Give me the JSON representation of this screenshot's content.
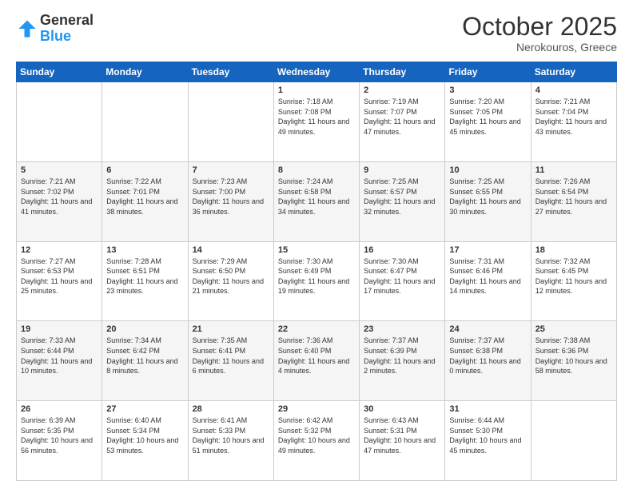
{
  "header": {
    "logo": {
      "general": "General",
      "blue": "Blue"
    },
    "month": "October 2025",
    "location": "Nerokouros, Greece"
  },
  "days_of_week": [
    "Sunday",
    "Monday",
    "Tuesday",
    "Wednesday",
    "Thursday",
    "Friday",
    "Saturday"
  ],
  "weeks": [
    [
      {
        "day": "",
        "info": ""
      },
      {
        "day": "",
        "info": ""
      },
      {
        "day": "",
        "info": ""
      },
      {
        "day": "1",
        "info": "Sunrise: 7:18 AM\nSunset: 7:08 PM\nDaylight: 11 hours and 49 minutes."
      },
      {
        "day": "2",
        "info": "Sunrise: 7:19 AM\nSunset: 7:07 PM\nDaylight: 11 hours and 47 minutes."
      },
      {
        "day": "3",
        "info": "Sunrise: 7:20 AM\nSunset: 7:05 PM\nDaylight: 11 hours and 45 minutes."
      },
      {
        "day": "4",
        "info": "Sunrise: 7:21 AM\nSunset: 7:04 PM\nDaylight: 11 hours and 43 minutes."
      }
    ],
    [
      {
        "day": "5",
        "info": "Sunrise: 7:21 AM\nSunset: 7:02 PM\nDaylight: 11 hours and 41 minutes."
      },
      {
        "day": "6",
        "info": "Sunrise: 7:22 AM\nSunset: 7:01 PM\nDaylight: 11 hours and 38 minutes."
      },
      {
        "day": "7",
        "info": "Sunrise: 7:23 AM\nSunset: 7:00 PM\nDaylight: 11 hours and 36 minutes."
      },
      {
        "day": "8",
        "info": "Sunrise: 7:24 AM\nSunset: 6:58 PM\nDaylight: 11 hours and 34 minutes."
      },
      {
        "day": "9",
        "info": "Sunrise: 7:25 AM\nSunset: 6:57 PM\nDaylight: 11 hours and 32 minutes."
      },
      {
        "day": "10",
        "info": "Sunrise: 7:25 AM\nSunset: 6:55 PM\nDaylight: 11 hours and 30 minutes."
      },
      {
        "day": "11",
        "info": "Sunrise: 7:26 AM\nSunset: 6:54 PM\nDaylight: 11 hours and 27 minutes."
      }
    ],
    [
      {
        "day": "12",
        "info": "Sunrise: 7:27 AM\nSunset: 6:53 PM\nDaylight: 11 hours and 25 minutes."
      },
      {
        "day": "13",
        "info": "Sunrise: 7:28 AM\nSunset: 6:51 PM\nDaylight: 11 hours and 23 minutes."
      },
      {
        "day": "14",
        "info": "Sunrise: 7:29 AM\nSunset: 6:50 PM\nDaylight: 11 hours and 21 minutes."
      },
      {
        "day": "15",
        "info": "Sunrise: 7:30 AM\nSunset: 6:49 PM\nDaylight: 11 hours and 19 minutes."
      },
      {
        "day": "16",
        "info": "Sunrise: 7:30 AM\nSunset: 6:47 PM\nDaylight: 11 hours and 17 minutes."
      },
      {
        "day": "17",
        "info": "Sunrise: 7:31 AM\nSunset: 6:46 PM\nDaylight: 11 hours and 14 minutes."
      },
      {
        "day": "18",
        "info": "Sunrise: 7:32 AM\nSunset: 6:45 PM\nDaylight: 11 hours and 12 minutes."
      }
    ],
    [
      {
        "day": "19",
        "info": "Sunrise: 7:33 AM\nSunset: 6:44 PM\nDaylight: 11 hours and 10 minutes."
      },
      {
        "day": "20",
        "info": "Sunrise: 7:34 AM\nSunset: 6:42 PM\nDaylight: 11 hours and 8 minutes."
      },
      {
        "day": "21",
        "info": "Sunrise: 7:35 AM\nSunset: 6:41 PM\nDaylight: 11 hours and 6 minutes."
      },
      {
        "day": "22",
        "info": "Sunrise: 7:36 AM\nSunset: 6:40 PM\nDaylight: 11 hours and 4 minutes."
      },
      {
        "day": "23",
        "info": "Sunrise: 7:37 AM\nSunset: 6:39 PM\nDaylight: 11 hours and 2 minutes."
      },
      {
        "day": "24",
        "info": "Sunrise: 7:37 AM\nSunset: 6:38 PM\nDaylight: 11 hours and 0 minutes."
      },
      {
        "day": "25",
        "info": "Sunrise: 7:38 AM\nSunset: 6:36 PM\nDaylight: 10 hours and 58 minutes."
      }
    ],
    [
      {
        "day": "26",
        "info": "Sunrise: 6:39 AM\nSunset: 5:35 PM\nDaylight: 10 hours and 56 minutes."
      },
      {
        "day": "27",
        "info": "Sunrise: 6:40 AM\nSunset: 5:34 PM\nDaylight: 10 hours and 53 minutes."
      },
      {
        "day": "28",
        "info": "Sunrise: 6:41 AM\nSunset: 5:33 PM\nDaylight: 10 hours and 51 minutes."
      },
      {
        "day": "29",
        "info": "Sunrise: 6:42 AM\nSunset: 5:32 PM\nDaylight: 10 hours and 49 minutes."
      },
      {
        "day": "30",
        "info": "Sunrise: 6:43 AM\nSunset: 5:31 PM\nDaylight: 10 hours and 47 minutes."
      },
      {
        "day": "31",
        "info": "Sunrise: 6:44 AM\nSunset: 5:30 PM\nDaylight: 10 hours and 45 minutes."
      },
      {
        "day": "",
        "info": ""
      }
    ]
  ]
}
